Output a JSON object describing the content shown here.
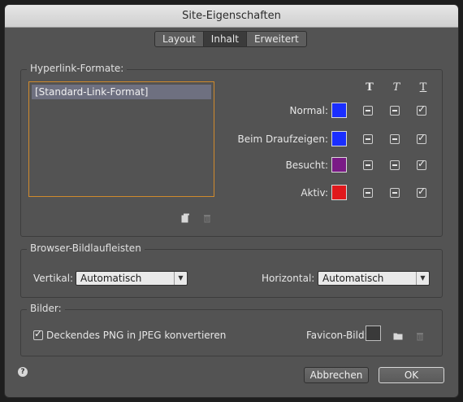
{
  "window": {
    "title": "Site-Eigenschaften"
  },
  "tabs": [
    {
      "label": "Layout",
      "active": false
    },
    {
      "label": "Inhalt",
      "active": true
    },
    {
      "label": "Erweitert",
      "active": false
    }
  ],
  "hyperlink": {
    "legend": "Hyperlink-Formate:",
    "list_items": [
      "[Standard-Link-Format]"
    ],
    "format_columns": [
      "T",
      "T",
      "T"
    ],
    "rows": [
      {
        "label": "Normal:",
        "color": "#1a2eff",
        "col1": "dash",
        "col2": "dash",
        "col3": "tick"
      },
      {
        "label": "Beim Draufzeigen:",
        "color": "#1a2eff",
        "col1": "dash",
        "col2": "dash",
        "col3": "tick"
      },
      {
        "label": "Besucht:",
        "color": "#7a1a86",
        "col1": "dash",
        "col2": "dash",
        "col3": "tick"
      },
      {
        "label": "Aktiv:",
        "color": "#e0181c",
        "col1": "dash",
        "col2": "dash",
        "col3": "tick"
      }
    ],
    "new_icon": "new-document-icon",
    "delete_icon": "trash-icon"
  },
  "browser": {
    "legend": "Browser-Bildlaufleisten",
    "vertical_label": "Vertikal:",
    "vertical_value": "Automatisch",
    "horizontal_label": "Horizontal:",
    "horizontal_value": "Automatisch"
  },
  "images": {
    "legend": "Bilder:",
    "png_checkbox_label": "Deckendes PNG in JPEG konvertieren",
    "png_checked": true,
    "favicon_label": "Favicon-Bild:",
    "folder_icon": "folder-icon",
    "delete_icon": "trash-icon"
  },
  "footer": {
    "help_icon": "help-icon",
    "help_glyph": "?",
    "cancel_label": "Abbrechen",
    "ok_label": "OK"
  }
}
